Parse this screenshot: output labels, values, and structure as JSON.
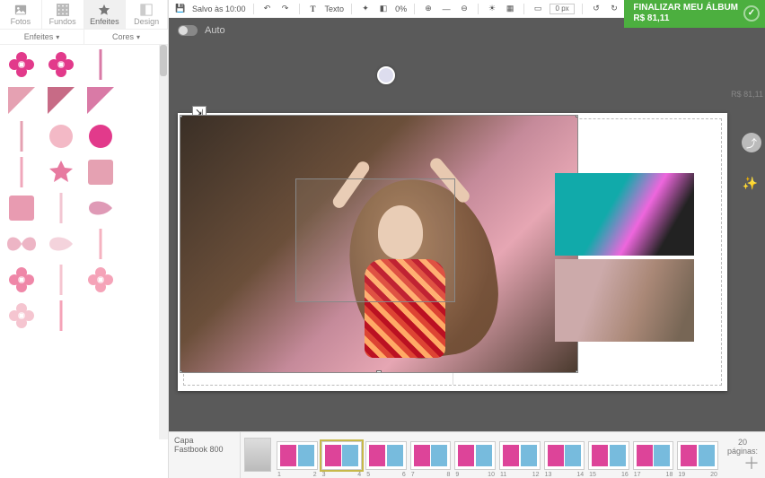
{
  "sidebar": {
    "tabs": [
      {
        "label": "Fotos",
        "icon": "image-icon"
      },
      {
        "label": "Fundos",
        "icon": "pattern-icon"
      },
      {
        "label": "Enfeites",
        "icon": "star-icon"
      },
      {
        "label": "Design",
        "icon": "layout-icon"
      }
    ],
    "active_tab": 2,
    "filters": {
      "left": "Enfeites",
      "right": "Cores"
    },
    "ornament_colors": [
      "#e23a8b",
      "#e23a8b",
      "#d97aa6",
      "#e5a1b2",
      "#c76b86",
      "#d97aa6",
      "#e5a1b2",
      "#f3b9c6",
      "#e23a8b",
      "#f0a7bb",
      "#e77aa0",
      "#e5a1b2",
      "#e89bb1",
      "#f2c6d2",
      "#d26f97",
      "#e8a2b7",
      "#f0c1cd",
      "#f5b2c0",
      "#ef87a8",
      "#f5c5d0",
      "#f5a3b8",
      "#f5c5d0",
      "#f5a3b8"
    ]
  },
  "toolbar": {
    "save_status": "Salvo às 10:00",
    "text_label": "Texto",
    "opacity_value": "0%",
    "px_value": "0 px"
  },
  "auto_label": "Auto",
  "finalize": {
    "line1": "FINALIZAR MEU ÁLBUM",
    "line2": "R$ 81,11"
  },
  "price_echo": "R$ 81,11",
  "cover": {
    "line1": "Capa",
    "line2": "Fastbook 800"
  },
  "pages_label": "páginas:",
  "pages_count": "20",
  "selected_spread_index": 1,
  "spreads": [
    {
      "l": "1",
      "r": "2"
    },
    {
      "l": "3",
      "r": "4"
    },
    {
      "l": "5",
      "r": "6"
    },
    {
      "l": "7",
      "r": "8"
    },
    {
      "l": "9",
      "r": "10"
    },
    {
      "l": "11",
      "r": "12"
    },
    {
      "l": "13",
      "r": "14"
    },
    {
      "l": "15",
      "r": "16"
    },
    {
      "l": "17",
      "r": "18"
    },
    {
      "l": "19",
      "r": "20"
    }
  ]
}
